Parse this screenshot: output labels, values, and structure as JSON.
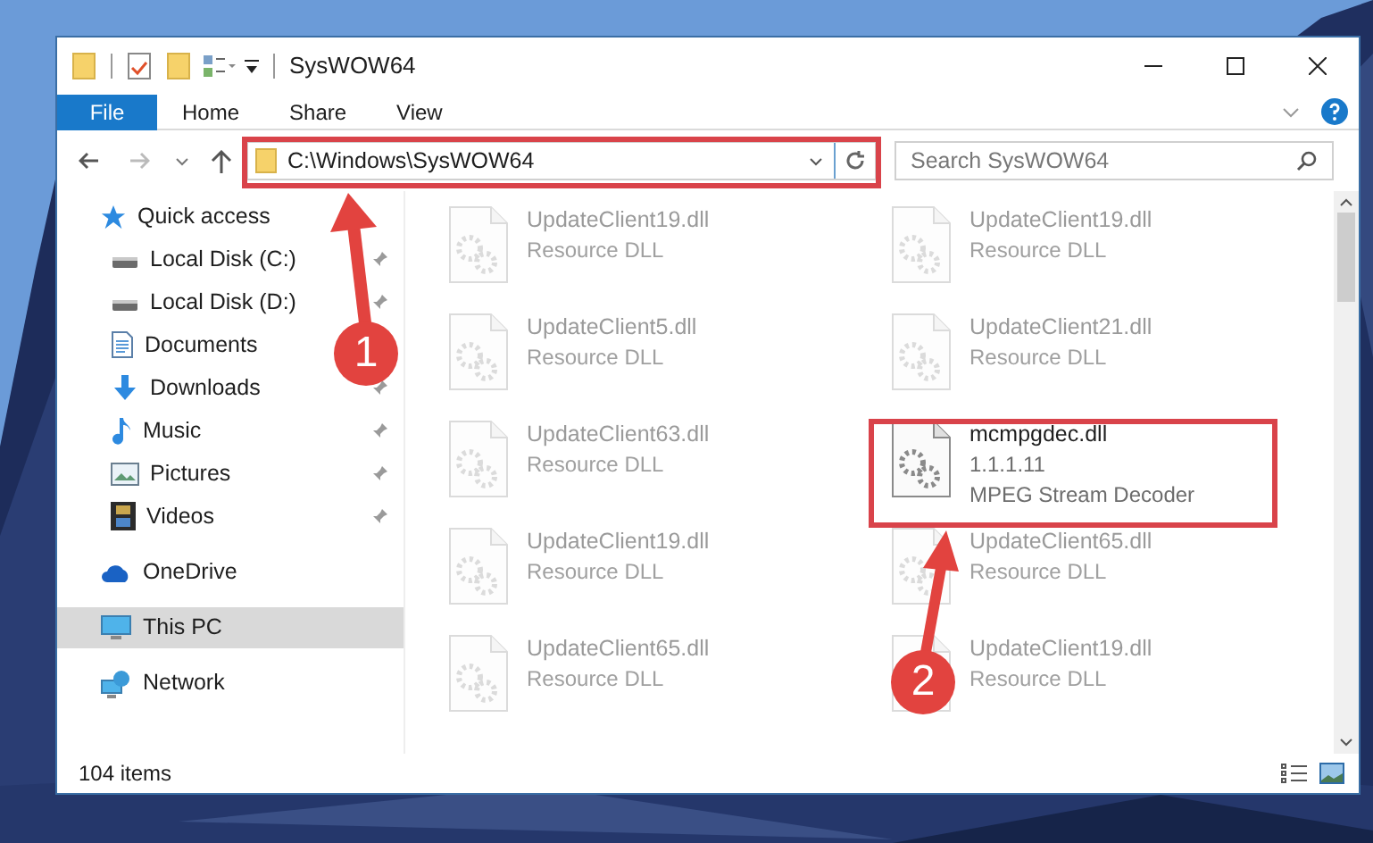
{
  "window": {
    "title": "SysWOW64"
  },
  "ribbon_tabs": [
    {
      "label": "File",
      "kind": "file"
    },
    {
      "label": "Home",
      "kind": "tab"
    },
    {
      "label": "Share",
      "kind": "tab"
    },
    {
      "label": "View",
      "kind": "tab"
    }
  ],
  "address_bar": {
    "path": "C:\\Windows\\SysWOW64"
  },
  "search": {
    "placeholder": "Search SysWOW64"
  },
  "sidebar": {
    "items": [
      {
        "label": "Quick access",
        "kind": "star",
        "selected": false,
        "children": [
          {
            "label": "Local Disk (C:)",
            "kind": "drive",
            "pinned": true
          },
          {
            "label": "Local Disk (D:)",
            "kind": "drive",
            "pinned": true
          },
          {
            "label": "Documents",
            "kind": "document",
            "pinned": false
          },
          {
            "label": "Downloads",
            "kind": "download",
            "pinned": true
          },
          {
            "label": "Music",
            "kind": "music",
            "pinned": true
          },
          {
            "label": "Pictures",
            "kind": "pictures",
            "pinned": true
          },
          {
            "label": "Videos",
            "kind": "videos",
            "pinned": true
          }
        ]
      },
      {
        "label": "OneDrive",
        "kind": "cloud",
        "selected": false
      },
      {
        "label": "This PC",
        "kind": "pc",
        "selected": true
      },
      {
        "label": "Network",
        "kind": "network",
        "selected": false
      }
    ]
  },
  "files": [
    {
      "name": "UpdateClient19.dll",
      "lines": [
        "Resource DLL"
      ],
      "faded": true
    },
    {
      "name": "UpdateClient19.dll",
      "lines": [
        "Resource DLL"
      ],
      "faded": true
    },
    {
      "name": "UpdateClient5.dll",
      "lines": [
        "Resource DLL"
      ],
      "faded": true
    },
    {
      "name": "UpdateClient21.dll",
      "lines": [
        "Resource DLL"
      ],
      "faded": true
    },
    {
      "name": "UpdateClient63.dll",
      "lines": [
        "Resource DLL"
      ],
      "faded": true
    },
    {
      "name": "mcmpgdec.dll",
      "lines": [
        "1.1.1.11",
        "MPEG Stream Decoder"
      ],
      "faded": false
    },
    {
      "name": "UpdateClient19.dll",
      "lines": [
        "Resource DLL"
      ],
      "faded": true
    },
    {
      "name": "UpdateClient65.dll",
      "lines": [
        "Resource DLL"
      ],
      "faded": true
    },
    {
      "name": "UpdateClient65.dll",
      "lines": [
        "Resource DLL"
      ],
      "faded": true
    },
    {
      "name": "UpdateClient19.dll",
      "lines": [
        "Resource DLL"
      ],
      "faded": true
    }
  ],
  "status_bar": {
    "count": "104 items"
  },
  "annotations": [
    {
      "number": "1"
    },
    {
      "number": "2"
    }
  ]
}
